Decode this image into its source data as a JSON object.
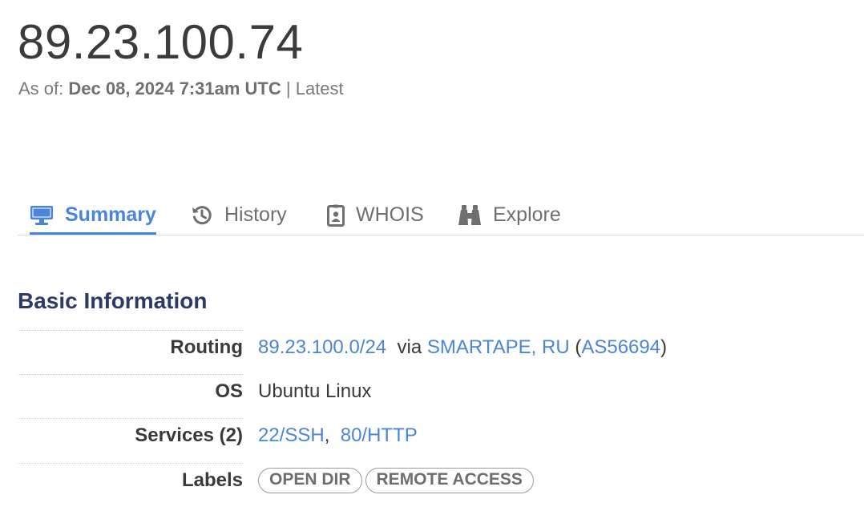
{
  "header": {
    "ip": "89.23.100.74",
    "as_of_prefix": "As of:",
    "as_of_date": "Dec 08, 2024 7:31am UTC",
    "as_of_separator": "|",
    "as_of_suffix": "Latest"
  },
  "tabs": [
    {
      "label": "Summary",
      "icon": "monitor-icon",
      "active": true
    },
    {
      "label": "History",
      "icon": "history-icon",
      "active": false
    },
    {
      "label": "WHOIS",
      "icon": "id-card-icon",
      "active": false
    },
    {
      "label": "Explore",
      "icon": "binoculars-icon",
      "active": false
    }
  ],
  "basic_info": {
    "title": "Basic Information",
    "routing": {
      "label": "Routing",
      "prefix": "89.23.100.0/24",
      "via": "via",
      "org": "SMARTAPE, RU",
      "open_paren": "(",
      "asn": "AS56694",
      "close_paren": ")"
    },
    "os": {
      "label": "OS",
      "value": "Ubuntu Linux"
    },
    "services": {
      "label": "Services (2)",
      "items": [
        "22/SSH",
        "80/HTTP"
      ],
      "separator": ","
    },
    "labels": {
      "label": "Labels",
      "items": [
        "OPEN DIR",
        "REMOTE ACCESS"
      ]
    }
  },
  "colors": {
    "accent": "#4a86d8",
    "section_title": "#2c3a66"
  }
}
